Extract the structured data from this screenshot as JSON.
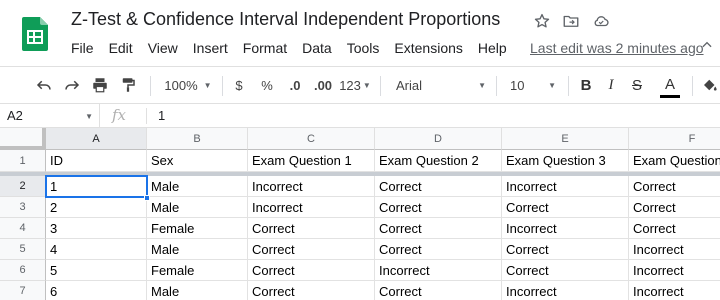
{
  "title": "Z-Test & Confidence Interval Independent Proportions",
  "menu": [
    "File",
    "Edit",
    "View",
    "Insert",
    "Format",
    "Data",
    "Tools",
    "Extensions",
    "Help"
  ],
  "last_edit": "Last edit was 2 minutes ago",
  "toolbar": {
    "zoom": "100%",
    "currency": "$",
    "percent": "%",
    "dec_decrease": ".0",
    "dec_increase": ".00",
    "more_formats": "123",
    "font": "Arial",
    "font_size": "10",
    "bold": "B",
    "italic": "I",
    "underline_text": "A"
  },
  "formula_bar": {
    "cell_ref": "A2",
    "fx": "fx",
    "value": "1"
  },
  "columns": [
    "A",
    "B",
    "C",
    "D",
    "E",
    "F"
  ],
  "rows": [
    {
      "n": "1",
      "cells": [
        "ID",
        "Sex",
        "Exam Question 1",
        "Exam Question 2",
        "Exam Question 3",
        "Exam Question"
      ]
    },
    {
      "n": "2",
      "cells": [
        "1",
        "Male",
        "Incorrect",
        "Correct",
        "Incorrect",
        "Correct"
      ]
    },
    {
      "n": "3",
      "cells": [
        "2",
        "Male",
        "Incorrect",
        "Correct",
        "Correct",
        "Correct"
      ]
    },
    {
      "n": "4",
      "cells": [
        "3",
        "Female",
        "Correct",
        "Correct",
        "Incorrect",
        "Correct"
      ]
    },
    {
      "n": "5",
      "cells": [
        "4",
        "Male",
        "Correct",
        "Correct",
        "Correct",
        "Incorrect"
      ]
    },
    {
      "n": "6",
      "cells": [
        "5",
        "Female",
        "Correct",
        "Incorrect",
        "Correct",
        "Incorrect"
      ]
    },
    {
      "n": "7",
      "cells": [
        "6",
        "Male",
        "Correct",
        "Correct",
        "Incorrect",
        "Incorrect"
      ]
    }
  ],
  "colors": {
    "sheets_green": "#0f9d58",
    "selection_blue": "#1a73e8",
    "header_bg": "#f8f9fa"
  }
}
